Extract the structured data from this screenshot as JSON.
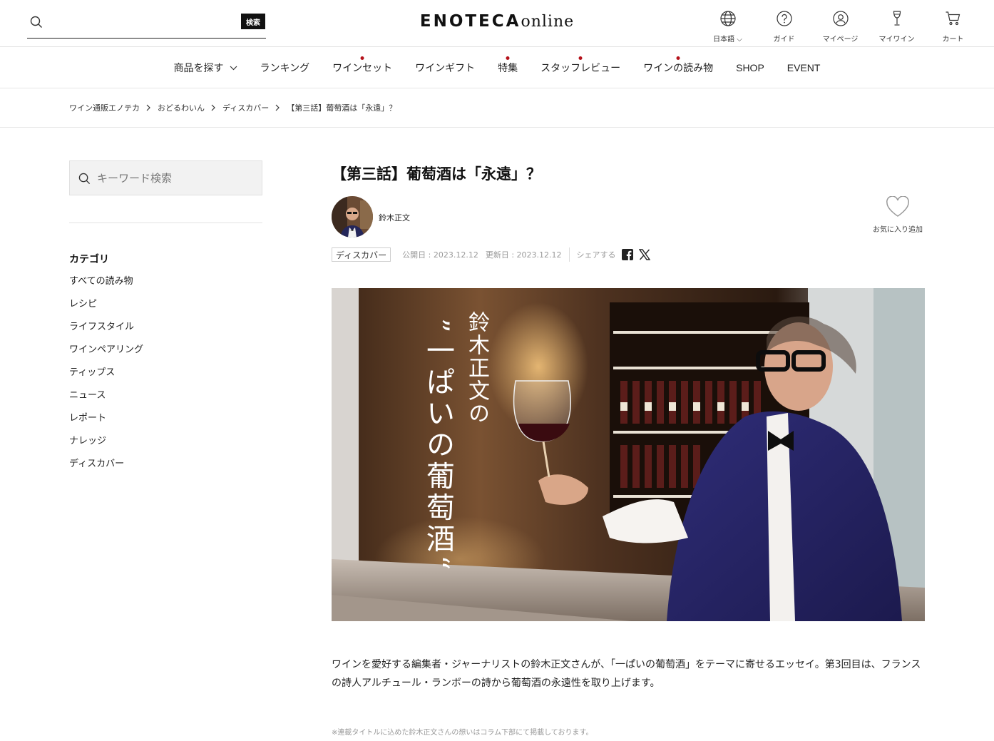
{
  "header": {
    "search_button": "検索",
    "search_placeholder": "",
    "logo_bold": "ENOTECA",
    "logo_light": "online",
    "icons": [
      {
        "name": "globe-icon",
        "label": "日本語"
      },
      {
        "name": "help-icon",
        "label": "ガイド"
      },
      {
        "name": "user-icon",
        "label": "マイページ"
      },
      {
        "name": "wine-glass-icon",
        "label": "マイワイン"
      },
      {
        "name": "cart-icon",
        "label": "カート"
      }
    ]
  },
  "nav": {
    "items": [
      {
        "label": "商品を探す"
      },
      {
        "label": "ランキング"
      },
      {
        "label": "ワインセット"
      },
      {
        "label": "ワインギフト"
      },
      {
        "label": "特集"
      },
      {
        "label": "スタッフレビュー"
      },
      {
        "label": "ワインの読み物"
      },
      {
        "label": "SHOP"
      },
      {
        "label": "EVENT"
      }
    ],
    "accent_color": "#b5121b"
  },
  "breadcrumb": [
    "ワイン通販エノテカ",
    "おどるわいん",
    "ディスカバー",
    "【第三話】葡萄酒は「永遠」？"
  ],
  "sidebar": {
    "search_placeholder": "キーワード検索",
    "category_title": "カテゴリ",
    "categories": [
      "すべての読み物",
      "レシピ",
      "ライフスタイル",
      "ワインペアリング",
      "ティップス",
      "ニュース",
      "レポート",
      "ナレッジ",
      "ディスカバー"
    ]
  },
  "article": {
    "title": "【第三話】葡萄酒は「永遠」？",
    "author": "鈴木正文",
    "favorite_label": "お気に入り追加",
    "tag": "ディスカバー",
    "published": "公開日 : 2023.12.12",
    "updated": "更新日 : 2023.12.12",
    "share_label": "シェアする",
    "hero_title_line1": "鈴木正文の",
    "hero_title_line2": "”一ぱいの葡萄酒“",
    "body": "ワインを愛好する編集者・ジャーナリストの鈴木正文さんが、「一ぱいの葡萄酒」をテーマに寄せるエッセイ。第3回目は、フランスの詩人アルチュール・ランボーの詩から葡萄酒の永遠性を取り上げます。",
    "note": "※連載タイトルに込めた鈴木正文さんの想いはコラム下部にて掲載しております。"
  }
}
